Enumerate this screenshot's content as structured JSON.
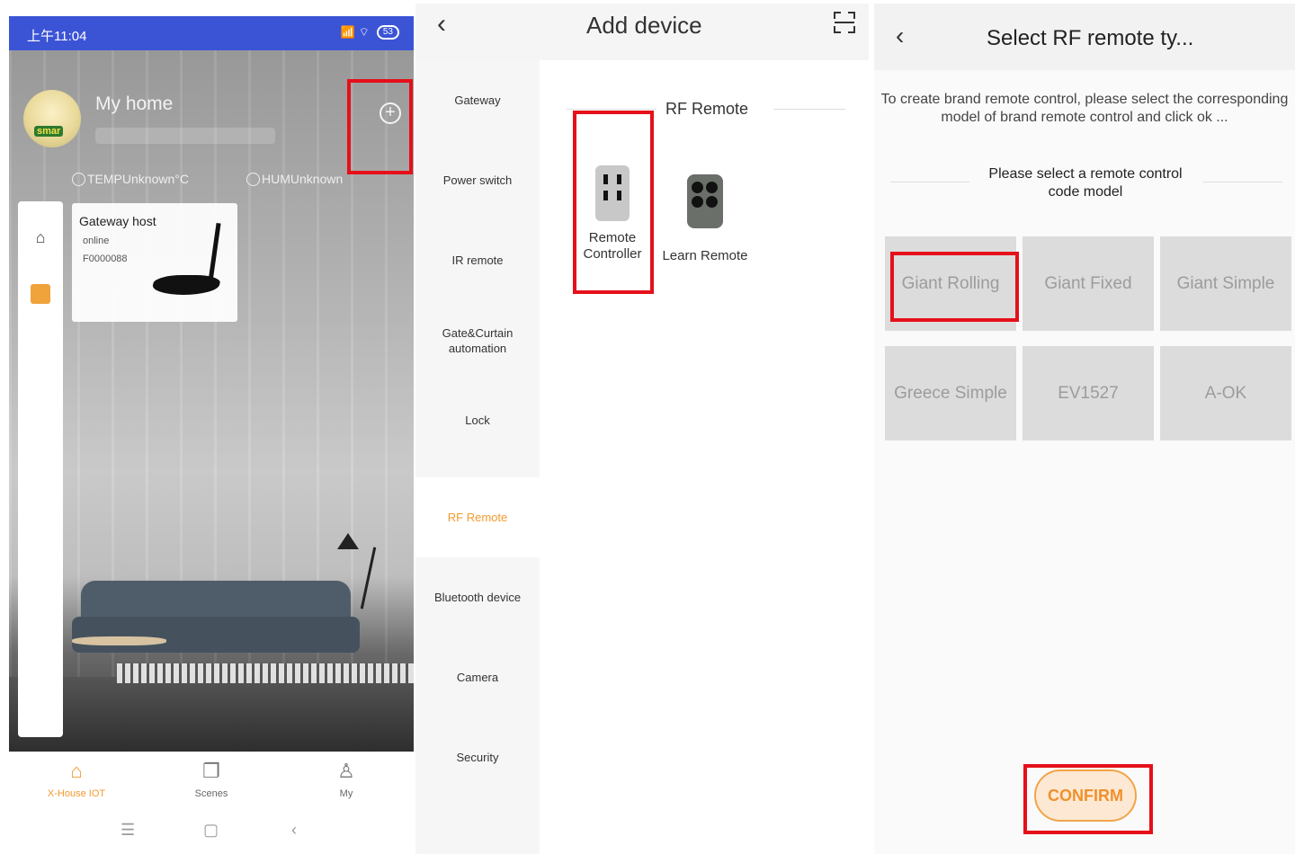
{
  "panel1": {
    "status_time": "上午11:04",
    "status_icons": "📶 ⌔",
    "battery": "53",
    "home_name": "My home",
    "temperature": "TEMPUnknown°C",
    "humidity": "HUMUnknown",
    "gateway_card": {
      "title": "Gateway host",
      "status": "online",
      "device_id": "F0000088"
    },
    "avatar_logo": "smar",
    "tabs": [
      {
        "label": "X-House IOT",
        "icon": "home-icon",
        "glyph": "⌂"
      },
      {
        "label": "Scenes",
        "icon": "scenes-icon",
        "glyph": "❐"
      },
      {
        "label": "My",
        "icon": "user-icon",
        "glyph": "♙"
      }
    ],
    "nav": {
      "menu": "☰",
      "home": "▢",
      "back": "‹"
    }
  },
  "panel2": {
    "title": "Add device",
    "back_glyph": "‹",
    "categories": [
      "Gateway",
      "Power switch",
      "IR remote",
      "Gate&Curtain automation",
      "Lock",
      "RF Remote",
      "Bluetooth device",
      "Camera",
      "Security"
    ],
    "active_category": "RF Remote",
    "section_title": "RF Remote",
    "devices": [
      "Remote Controller",
      "Learn Remote"
    ]
  },
  "panel3": {
    "title": "Select RF remote ty...",
    "back_glyph": "‹",
    "description": "To create brand remote control, please select the corresponding model of brand remote control and click ok ...",
    "section_title": "Please select a remote control code model",
    "options": [
      "Giant Rolling",
      "Giant Fixed",
      "Giant Simple",
      "Greece Simple",
      "EV1527",
      "A-OK"
    ],
    "confirm_label": "CONFIRM"
  },
  "colors": {
    "accent": "#f29a2e",
    "status_bar": "#3b54d6",
    "highlight": "#e5101a"
  }
}
